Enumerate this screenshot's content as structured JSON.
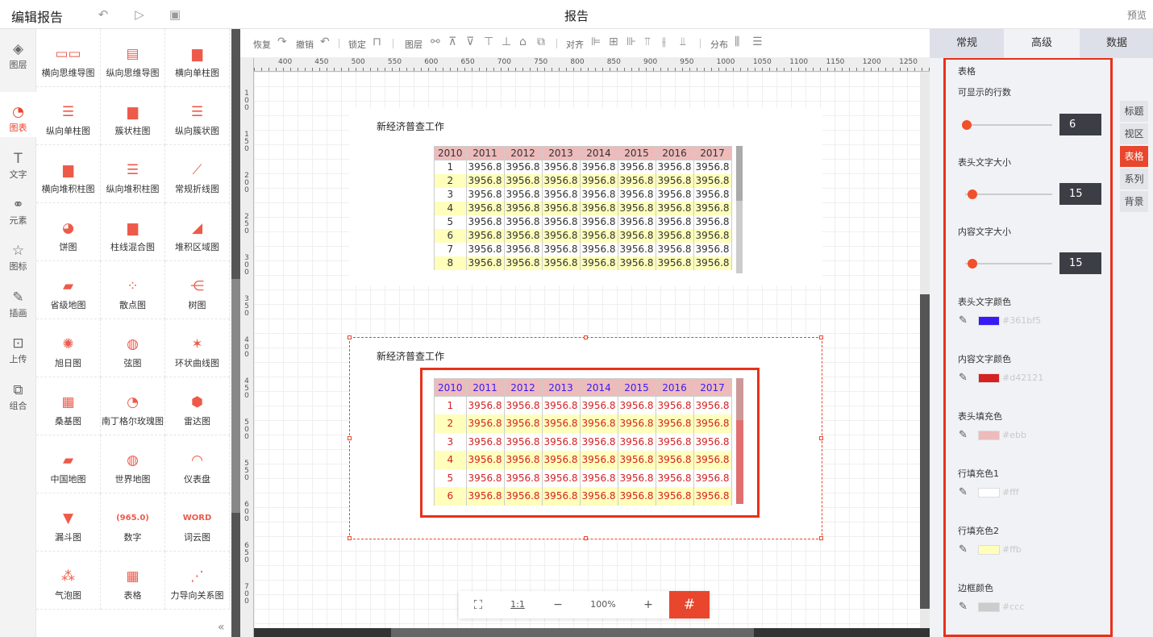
{
  "header": {
    "app_title": "编辑报告",
    "doc_title": "报告",
    "preview_label": "预览",
    "icons": [
      "undo-icon",
      "play-icon",
      "save-icon"
    ]
  },
  "leftnav": {
    "items": [
      {
        "label": "图层",
        "icon": "layers-icon",
        "active": false
      },
      {
        "label": "图表",
        "icon": "chart-icon",
        "active": true
      },
      {
        "label": "文字",
        "icon": "text-icon",
        "active": false
      },
      {
        "label": "元素",
        "icon": "shapes-icon",
        "active": false
      },
      {
        "label": "图标",
        "icon": "star-icon",
        "active": false
      },
      {
        "label": "插画",
        "icon": "palette-icon",
        "active": false
      },
      {
        "label": "上传",
        "icon": "upload-image-icon",
        "active": false
      },
      {
        "label": "组合",
        "icon": "group-icon",
        "active": false
      }
    ]
  },
  "components": [
    {
      "label": "横向思维导图",
      "glyph": "▭▭"
    },
    {
      "label": "纵向思维导图",
      "glyph": "▤"
    },
    {
      "label": "横向单柱图",
      "glyph": "▆"
    },
    {
      "label": "纵向单柱图",
      "glyph": "☰"
    },
    {
      "label": "簇状柱图",
      "glyph": "▆"
    },
    {
      "label": "纵向簇状图",
      "glyph": "☰"
    },
    {
      "label": "横向堆积柱图",
      "glyph": "▆"
    },
    {
      "label": "纵向堆积柱图",
      "glyph": "☰"
    },
    {
      "label": "常规折线图",
      "glyph": "⟋"
    },
    {
      "label": "饼图",
      "glyph": "◕"
    },
    {
      "label": "柱线混合图",
      "glyph": "▆"
    },
    {
      "label": "堆积区域图",
      "glyph": "◢"
    },
    {
      "label": "省级地图",
      "glyph": "▰"
    },
    {
      "label": "散点图",
      "glyph": "⁘"
    },
    {
      "label": "树图",
      "glyph": "⋲"
    },
    {
      "label": "旭日图",
      "glyph": "✺"
    },
    {
      "label": "弦图",
      "glyph": "◍"
    },
    {
      "label": "环状曲线图",
      "glyph": "✶"
    },
    {
      "label": "桑基图",
      "glyph": "▦"
    },
    {
      "label": "南丁格尔玫瑰图",
      "glyph": "◔"
    },
    {
      "label": "雷达图",
      "glyph": "⬢"
    },
    {
      "label": "中国地图",
      "glyph": "▰"
    },
    {
      "label": "世界地图",
      "glyph": "◍"
    },
    {
      "label": "仪表盘",
      "glyph": "◠"
    },
    {
      "label": "漏斗图",
      "glyph": "▼"
    },
    {
      "label": "数字",
      "glyph": "(965.0)"
    },
    {
      "label": "词云图",
      "glyph": "WORD"
    },
    {
      "label": "气泡图",
      "glyph": "⁂"
    },
    {
      "label": "表格",
      "glyph": "▦"
    },
    {
      "label": "力导向关系图",
      "glyph": "⋰"
    }
  ],
  "canvas_toolbar": {
    "redo_label": "恢复",
    "undo_label": "撤销",
    "lock_label": "锁定",
    "layer_label": "图层",
    "align_label": "对齐",
    "distribute_label": "分布"
  },
  "ruler": {
    "h_labels": [
      "400",
      "450",
      "500",
      "550",
      "600",
      "650",
      "700",
      "750",
      "800",
      "850",
      "900",
      "950",
      "1000",
      "1050",
      "1100",
      "1150",
      "1200",
      "1250"
    ],
    "v_labels": [
      "100",
      "150",
      "200",
      "250",
      "300",
      "350",
      "400",
      "450",
      "500",
      "550",
      "600",
      "650",
      "700"
    ]
  },
  "widget1": {
    "title": "新经济普查工作",
    "headers": [
      "2010",
      "2011",
      "2012",
      "2013",
      "2014",
      "2015",
      "2016",
      "2017"
    ],
    "rows": [
      [
        "1",
        "3956.8",
        "3956.8",
        "3956.8",
        "3956.8",
        "3956.8",
        "3956.8",
        "3956.8"
      ],
      [
        "2",
        "3956.8",
        "3956.8",
        "3956.8",
        "3956.8",
        "3956.8",
        "3956.8",
        "3956.8"
      ],
      [
        "3",
        "3956.8",
        "3956.8",
        "3956.8",
        "3956.8",
        "3956.8",
        "3956.8",
        "3956.8"
      ],
      [
        "4",
        "3956.8",
        "3956.8",
        "3956.8",
        "3956.8",
        "3956.8",
        "3956.8",
        "3956.8"
      ],
      [
        "5",
        "3956.8",
        "3956.8",
        "3956.8",
        "3956.8",
        "3956.8",
        "3956.8",
        "3956.8"
      ],
      [
        "6",
        "3956.8",
        "3956.8",
        "3956.8",
        "3956.8",
        "3956.8",
        "3956.8",
        "3956.8"
      ],
      [
        "7",
        "3956.8",
        "3956.8",
        "3956.8",
        "3956.8",
        "3956.8",
        "3956.8",
        "3956.8"
      ],
      [
        "8",
        "3956.8",
        "3956.8",
        "3956.8",
        "3956.8",
        "3956.8",
        "3956.8",
        "3956.8"
      ]
    ]
  },
  "widget2": {
    "title": "新经济普查工作",
    "headers": [
      "2010",
      "2011",
      "2012",
      "2013",
      "2014",
      "2015",
      "2016",
      "2017"
    ],
    "rows": [
      [
        "1",
        "3956.8",
        "3956.8",
        "3956.8",
        "3956.8",
        "3956.8",
        "3956.8",
        "3956.8"
      ],
      [
        "2",
        "3956.8",
        "3956.8",
        "3956.8",
        "3956.8",
        "3956.8",
        "3956.8",
        "3956.8"
      ],
      [
        "3",
        "3956.8",
        "3956.8",
        "3956.8",
        "3956.8",
        "3956.8",
        "3956.8",
        "3956.8"
      ],
      [
        "4",
        "3956.8",
        "3956.8",
        "3956.8",
        "3956.8",
        "3956.8",
        "3956.8",
        "3956.8"
      ],
      [
        "5",
        "3956.8",
        "3956.8",
        "3956.8",
        "3956.8",
        "3956.8",
        "3956.8",
        "3956.8"
      ],
      [
        "6",
        "3956.8",
        "3956.8",
        "3956.8",
        "3956.8",
        "3956.8",
        "3956.8",
        "3956.8"
      ]
    ]
  },
  "zoombar": {
    "actual_size_label": "1:1",
    "zoom_out": "−",
    "zoom_level": "100%",
    "zoom_in": "+"
  },
  "rightpanel": {
    "tabs": [
      {
        "label": "常规",
        "active": false
      },
      {
        "label": "高级",
        "active": true
      },
      {
        "label": "数据",
        "active": false
      }
    ],
    "section_title": "表格",
    "rows_label": "可显示的行数",
    "rows_value": "6",
    "rows_slider_fraction": 0.02,
    "header_font_label": "表头文字大小",
    "header_font_value": "15",
    "header_font_slider_fraction": 0.08,
    "content_font_label": "内容文字大小",
    "content_font_value": "15",
    "content_font_slider_fraction": 0.08,
    "colors": [
      {
        "label": "表头文字颜色",
        "hex": "#361bf5"
      },
      {
        "label": "内容文字颜色",
        "hex": "#d42121"
      },
      {
        "label": "表头填充色",
        "hex": "#ebb"
      },
      {
        "label": "行填充色1",
        "hex": "#fff"
      },
      {
        "label": "行填充色2",
        "hex": "#ffb"
      },
      {
        "label": "边框颜色",
        "hex": "#ccc"
      }
    ],
    "side_tabs": [
      {
        "label": "标题",
        "active": false
      },
      {
        "label": "视区",
        "active": false
      },
      {
        "label": "表格",
        "active": true
      },
      {
        "label": "系列",
        "active": false
      },
      {
        "label": "背景",
        "active": false
      }
    ]
  },
  "theme": {
    "accent": "#e8462d",
    "chart_red": "#ee5a4a"
  }
}
